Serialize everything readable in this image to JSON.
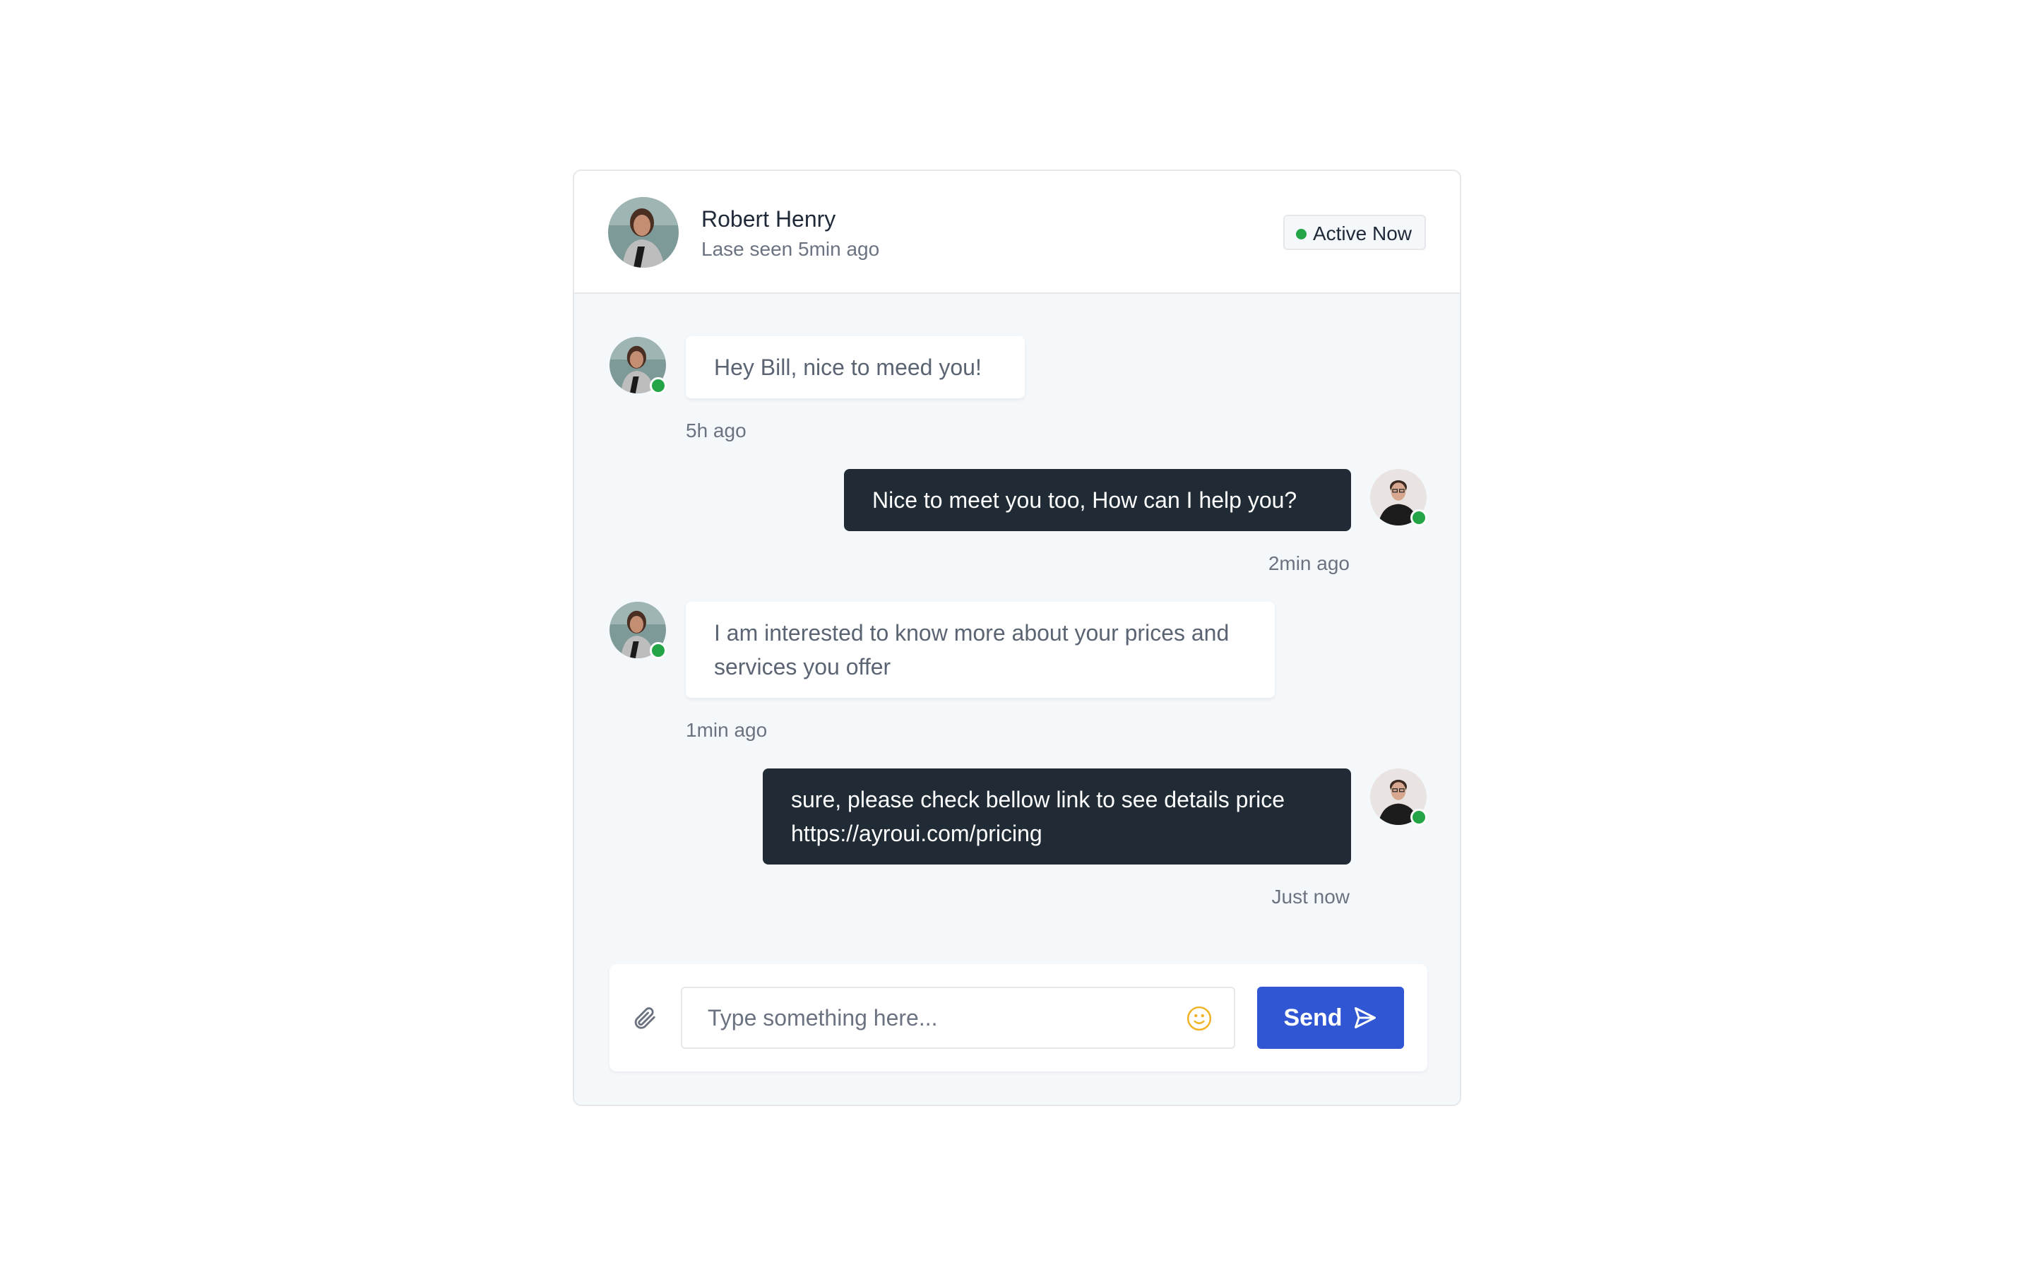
{
  "header": {
    "name": "Robert Henry",
    "subtitle": "Lase seen 5min ago",
    "status_badge": "Active Now"
  },
  "colors": {
    "online": "#22a447",
    "outgoing_bubble": "#212b36",
    "send_button": "#3056d3",
    "emoji_icon": "#f0b429"
  },
  "messages": [
    {
      "direction": "incoming",
      "text": "Hey Bill, nice to meed you!",
      "time": "5h ago",
      "avatar": "woman-avatar"
    },
    {
      "direction": "outgoing",
      "text": "Nice to meet you too, How can I help you?",
      "time": "2min ago",
      "avatar": "man-avatar"
    },
    {
      "direction": "incoming",
      "text": "I am interested to know more about your prices and services you offer",
      "time": "1min ago",
      "avatar": "woman-avatar"
    },
    {
      "direction": "outgoing",
      "text": "sure, please check bellow link to see details price https://ayroui.com/pricing",
      "time": "Just now",
      "avatar": "man-avatar"
    }
  ],
  "composer": {
    "placeholder": "Type something here...",
    "value": "",
    "send_label": "Send"
  }
}
